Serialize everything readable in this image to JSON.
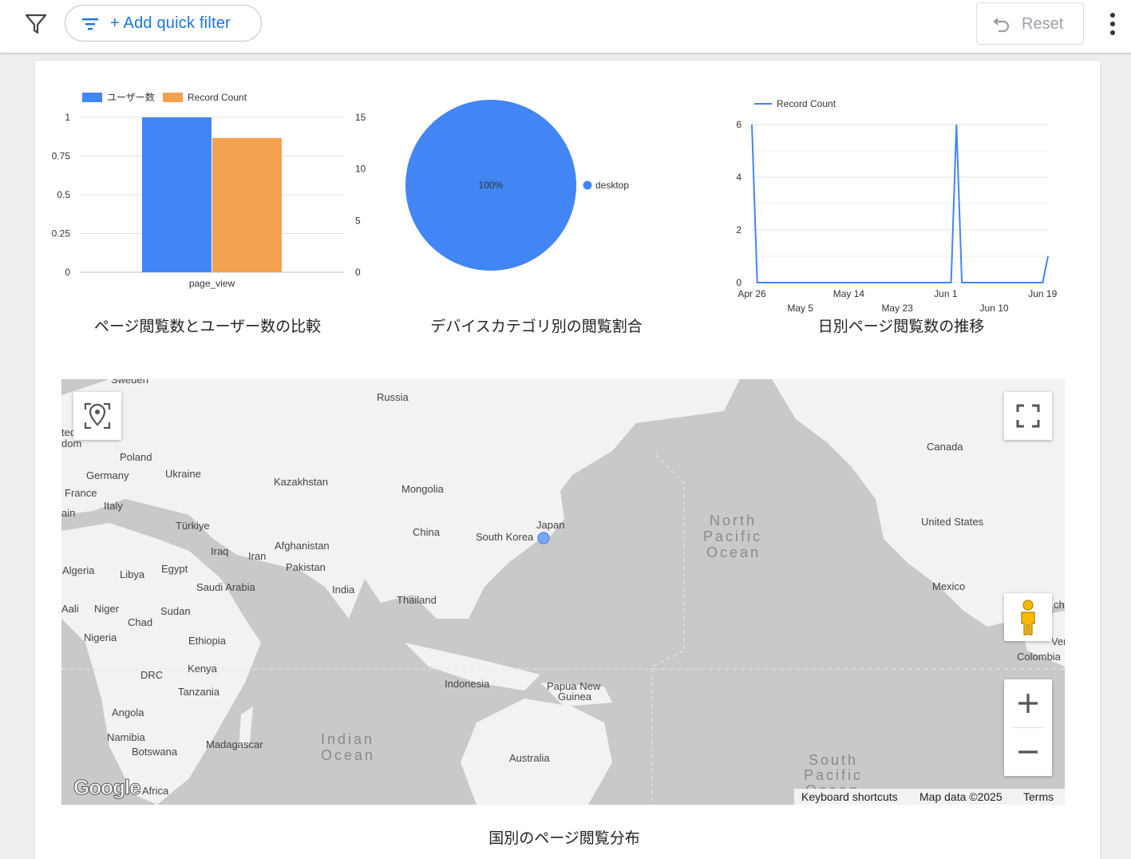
{
  "toolbar": {
    "quick_filter_label": "+ Add quick filter",
    "reset_label": "Reset",
    "icons": {
      "filter": "filter-funnel-icon",
      "quick_filter": "filter-list-icon",
      "reset": "undo-icon",
      "more": "more-vert-icon"
    }
  },
  "colors": {
    "accent": "#1a73e8",
    "series_blue": "#4285f4",
    "series_orange": "#f4a150",
    "map_land": "#f2f2f2",
    "map_water": "#c9c9c9"
  },
  "charts": [
    {
      "title": "ページ閲覧数とユーザー数の比較"
    },
    {
      "title": "デバイスカテゴリ別の閲覧割合"
    },
    {
      "title": "日別ページ閲覧数の推移"
    }
  ],
  "chart_data": [
    {
      "type": "bar",
      "categories": [
        "page_view"
      ],
      "series": [
        {
          "name": "ユーザー数",
          "values": [
            1
          ],
          "axis": "left",
          "color": "#4285f4"
        },
        {
          "name": "Record Count",
          "values": [
            13
          ],
          "axis": "right",
          "color": "#f4a150"
        }
      ],
      "ylim_left": [
        0,
        1
      ],
      "yticks_left": [
        "0",
        "0.25",
        "0.5",
        "0.75",
        "1"
      ],
      "ylim_right": [
        0,
        15
      ],
      "yticks_right": [
        "0",
        "5",
        "10",
        "15"
      ],
      "legend": "top-left",
      "grid": true
    },
    {
      "type": "pie",
      "categories": [
        "desktop"
      ],
      "values": [
        100
      ],
      "labels": [
        "100%"
      ],
      "colors": [
        "#4285f4"
      ],
      "legend": "right"
    },
    {
      "type": "line",
      "series": [
        {
          "name": "Record Count",
          "color": "#4285f4",
          "x": [
            "2025-04-26",
            "2025-04-27",
            "2025-06-02",
            "2025-06-03",
            "2025-06-04",
            "2025-06-19",
            "2025-06-20"
          ],
          "y": [
            6,
            0,
            0,
            6,
            0,
            0,
            1
          ]
        }
      ],
      "xticks": [
        "Apr 26",
        "May 5",
        "May 14",
        "May 23",
        "Jun 1",
        "Jun 10",
        "Jun 19"
      ],
      "yticks": [
        "0",
        "2",
        "4",
        "6"
      ],
      "ylim": [
        0,
        6
      ],
      "legend": "top-left",
      "grid": true
    }
  ],
  "map": {
    "title": "国別のページ閲覧分布",
    "marker_country": "Japan",
    "labels": {
      "russia": "Russia",
      "kazakhstan": "Kazakhstan",
      "mongolia": "Mongolia",
      "china": "China",
      "south_korea": "South Korea",
      "japan": "Japan",
      "canada": "Canada",
      "united_states": "United States",
      "mexico": "Mexico",
      "poland": "Poland",
      "germany": "Germany",
      "ukraine": "Ukraine",
      "france": "France",
      "italy": "Italy",
      "turkiye": "Türkiye",
      "iraq": "Iraq",
      "iran": "Iran",
      "afghanistan": "Afghanistan",
      "pakistan": "Pakistan",
      "india": "India",
      "thailand": "Thailand",
      "algeria": "Algeria",
      "libya": "Libya",
      "egypt": "Egypt",
      "saudi_arabia": "Saudi Arabia",
      "mali": "Mali",
      "niger": "Niger",
      "chad": "Chad",
      "sudan": "Sudan",
      "nigeria": "Nigeria",
      "ethiopia": "Ethiopia",
      "kenya": "Kenya",
      "drc": "DRC",
      "tanzania": "Tanzania",
      "angola": "Angola",
      "namibia": "Namibia",
      "botswana": "Botswana",
      "madagascar": "Madagascar",
      "indonesia": "Indonesia",
      "papua_new_guinea_1": "Papua New",
      "papua_new_guinea_2": "Guinea",
      "australia": "Australia",
      "colombia": "Colombia",
      "sweden": "Sweden",
      "africa": "Africa",
      "ven": "Ven",
      "united_kingdom_1": "ted",
      "united_kingdom_2": "dom",
      "spain": "ain",
      "mali2": "Aali",
      "chile": "chi"
    },
    "oceans": {
      "north_pacific_1": "North",
      "north_pacific_2": "Pacific",
      "north_pacific_3": "Ocean",
      "indian_1": "Indian",
      "indian_2": "Ocean",
      "south_pacific_1": "South",
      "south_pacific_2": "Pacific",
      "south_pacific_3": "Ocean"
    },
    "google_logo": "Google",
    "attribution": {
      "shortcuts": "Keyboard shortcuts",
      "map_data": "Map data ©2025",
      "terms": "Terms"
    },
    "controls": {
      "location": "location-pin-icon",
      "fullscreen": "fullscreen-icon",
      "pegman": "pegman-icon",
      "zoom_in": "zoom-in-icon",
      "zoom_out": "zoom-out-icon"
    }
  }
}
